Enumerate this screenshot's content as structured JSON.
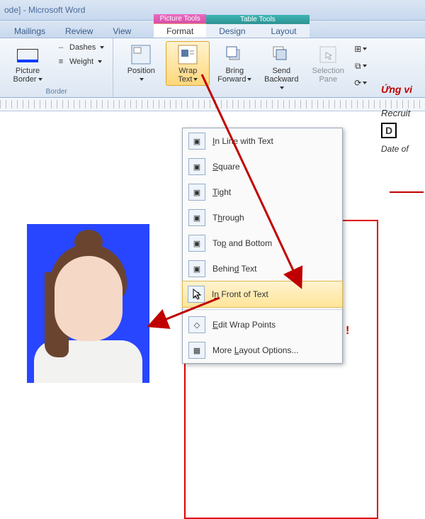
{
  "title": {
    "suffix": "ode] - Microsoft Word"
  },
  "tabs": {
    "mailings": "Mailings",
    "review": "Review",
    "view": "View"
  },
  "context_tabs": {
    "picture_tools": {
      "group": "Picture Tools",
      "tab": "Format"
    },
    "table_tools": {
      "group": "Table Tools",
      "design": "Design",
      "layout": "Layout"
    }
  },
  "ribbon": {
    "border": {
      "label": "Border",
      "picture_border": "Picture\nBorder",
      "dashes": "Dashes",
      "weight": "Weight"
    },
    "arrange": {
      "position": "Position",
      "wrap_text": "Wrap\nText",
      "bring_forward": "Bring\nForward",
      "send_backward": "Send\nBackward",
      "selection_pane": "Selection\nPane"
    }
  },
  "wrap_menu": {
    "in_line": "In Line with Text",
    "square": "Square",
    "tight": "Tight",
    "through": "Through",
    "top_bottom": "Top and Bottom",
    "behind": "Behind Text",
    "in_front": "In Front of Text",
    "edit_points": "Edit Wrap Points",
    "more": "More Layout Options..."
  },
  "doc_side": {
    "heading": "Ứng vi",
    "recruit": "Recruit",
    "badge": "D",
    "date": "Date of",
    "exclaim": "!"
  },
  "underline_keys": {
    "in_line_u": "I",
    "square_u": "S",
    "tight_u": "T",
    "through_u": "h",
    "top_bottom_u": "p",
    "behind_u": "d",
    "in_front_u": "n",
    "edit_u": "E",
    "more_u": "L"
  }
}
